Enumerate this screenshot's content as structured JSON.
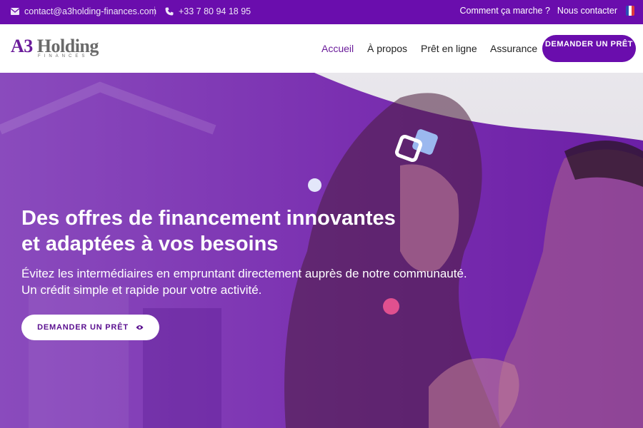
{
  "topbar": {
    "email": "contact@a3holding-finances.com",
    "phone": "+33 7 80 94 18 95",
    "how_it_works": "Comment ça marche ?",
    "contact": "Nous contacter",
    "email_icon": "envelope-icon",
    "phone_icon": "phone-icon",
    "flag_icon": "france-flag-icon"
  },
  "header": {
    "logo_main": "A3 Holding",
    "logo_sub": "FINANCES",
    "nav": {
      "home": "Accueil",
      "about": "À propos",
      "online_loan": "Prêt en ligne",
      "insurance": "Assurance"
    },
    "cta": "DEMANDER UN PRÊT"
  },
  "hero": {
    "title_line1": "Des offres de financement innovantes",
    "title_line2": "et adaptées à vos besoins",
    "subtitle_line1": "Évitez les intermédiaires en empruntant directement auprès de notre communauté.",
    "subtitle_line2": "Un crédit simple et rapide pour votre activité.",
    "cta": "DEMANDER UN PRÊT",
    "cta_icon": "eye-icon"
  },
  "colors": {
    "brand_purple": "#6a0dad",
    "accent_pink": "#e0508f",
    "overlay_purple": "#7b2fb0"
  }
}
